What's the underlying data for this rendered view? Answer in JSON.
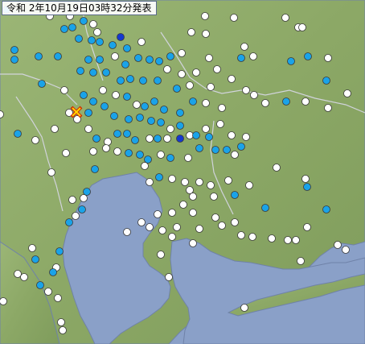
{
  "header": {
    "timestamp": "令和 2年10月19日03時32分発表"
  },
  "colors": {
    "sea": "#8aa0c8",
    "land": "#8eaa6a",
    "border": "#d8d8e8",
    "coast": "#6f82a8",
    "station_level_0": "#ffffff",
    "station_level_1": "#1aa3e8",
    "station_level_2": "#1438d0",
    "epicenter": "#ffd400",
    "epicenter_outline": "#d02000"
  },
  "legend_semantics": {
    "station_level_0": "white-dot",
    "station_level_1": "light-blue-dot",
    "station_level_2": "dark-blue-dot",
    "epicenter": "x-mark-icon"
  }
}
